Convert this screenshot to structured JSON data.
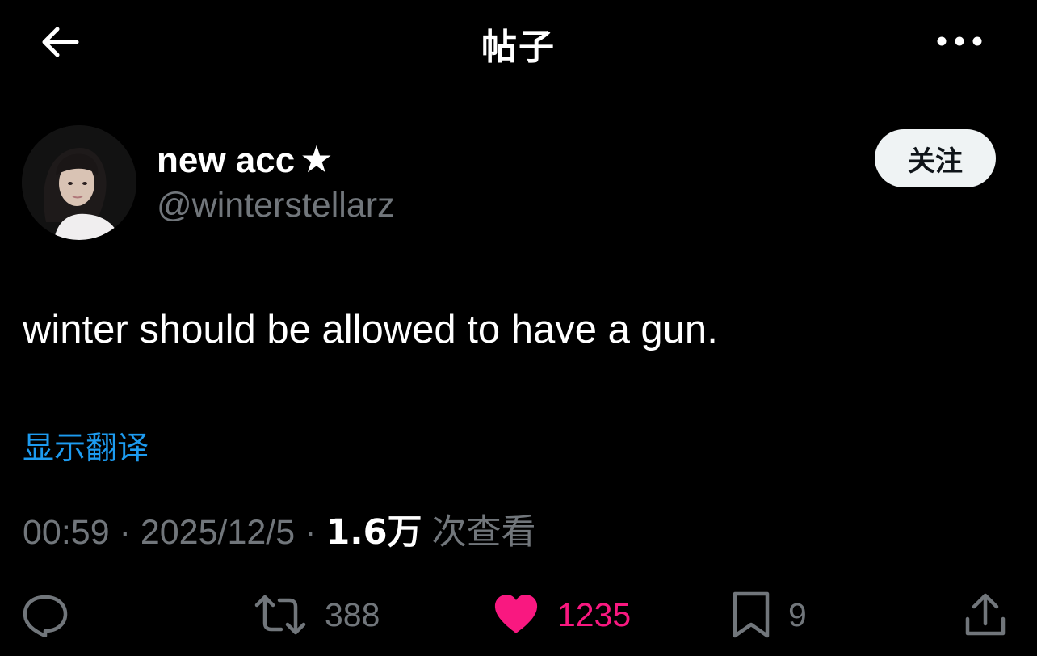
{
  "header": {
    "title": "帖子",
    "back_icon": "arrow-left-icon",
    "more_icon": "more-horizontal-icon"
  },
  "author": {
    "display_name": "new acc",
    "name_emoji": "★",
    "handle": "@winterstellarz",
    "follow_label": "关注"
  },
  "post": {
    "text": "winter should be allowed to have a gun.",
    "translate_label": "显示翻译"
  },
  "meta": {
    "time": "00:59",
    "sep1": "·",
    "date": "2025/12/5",
    "sep2": "·",
    "views_count": "1.6万",
    "views_label": "次查看"
  },
  "actions": {
    "reply": {
      "icon": "reply-icon"
    },
    "retweet": {
      "icon": "retweet-icon",
      "count": "388"
    },
    "like": {
      "icon": "heart-icon",
      "count": "1235",
      "liked": true
    },
    "bookmark": {
      "icon": "bookmark-icon",
      "count": "9"
    },
    "share": {
      "icon": "share-icon"
    }
  },
  "colors": {
    "background": "#000000",
    "text_primary": "#ffffff",
    "text_secondary": "#71767b",
    "link": "#1d9bf0",
    "like_active": "#f91880",
    "follow_bg": "#eff3f4"
  }
}
